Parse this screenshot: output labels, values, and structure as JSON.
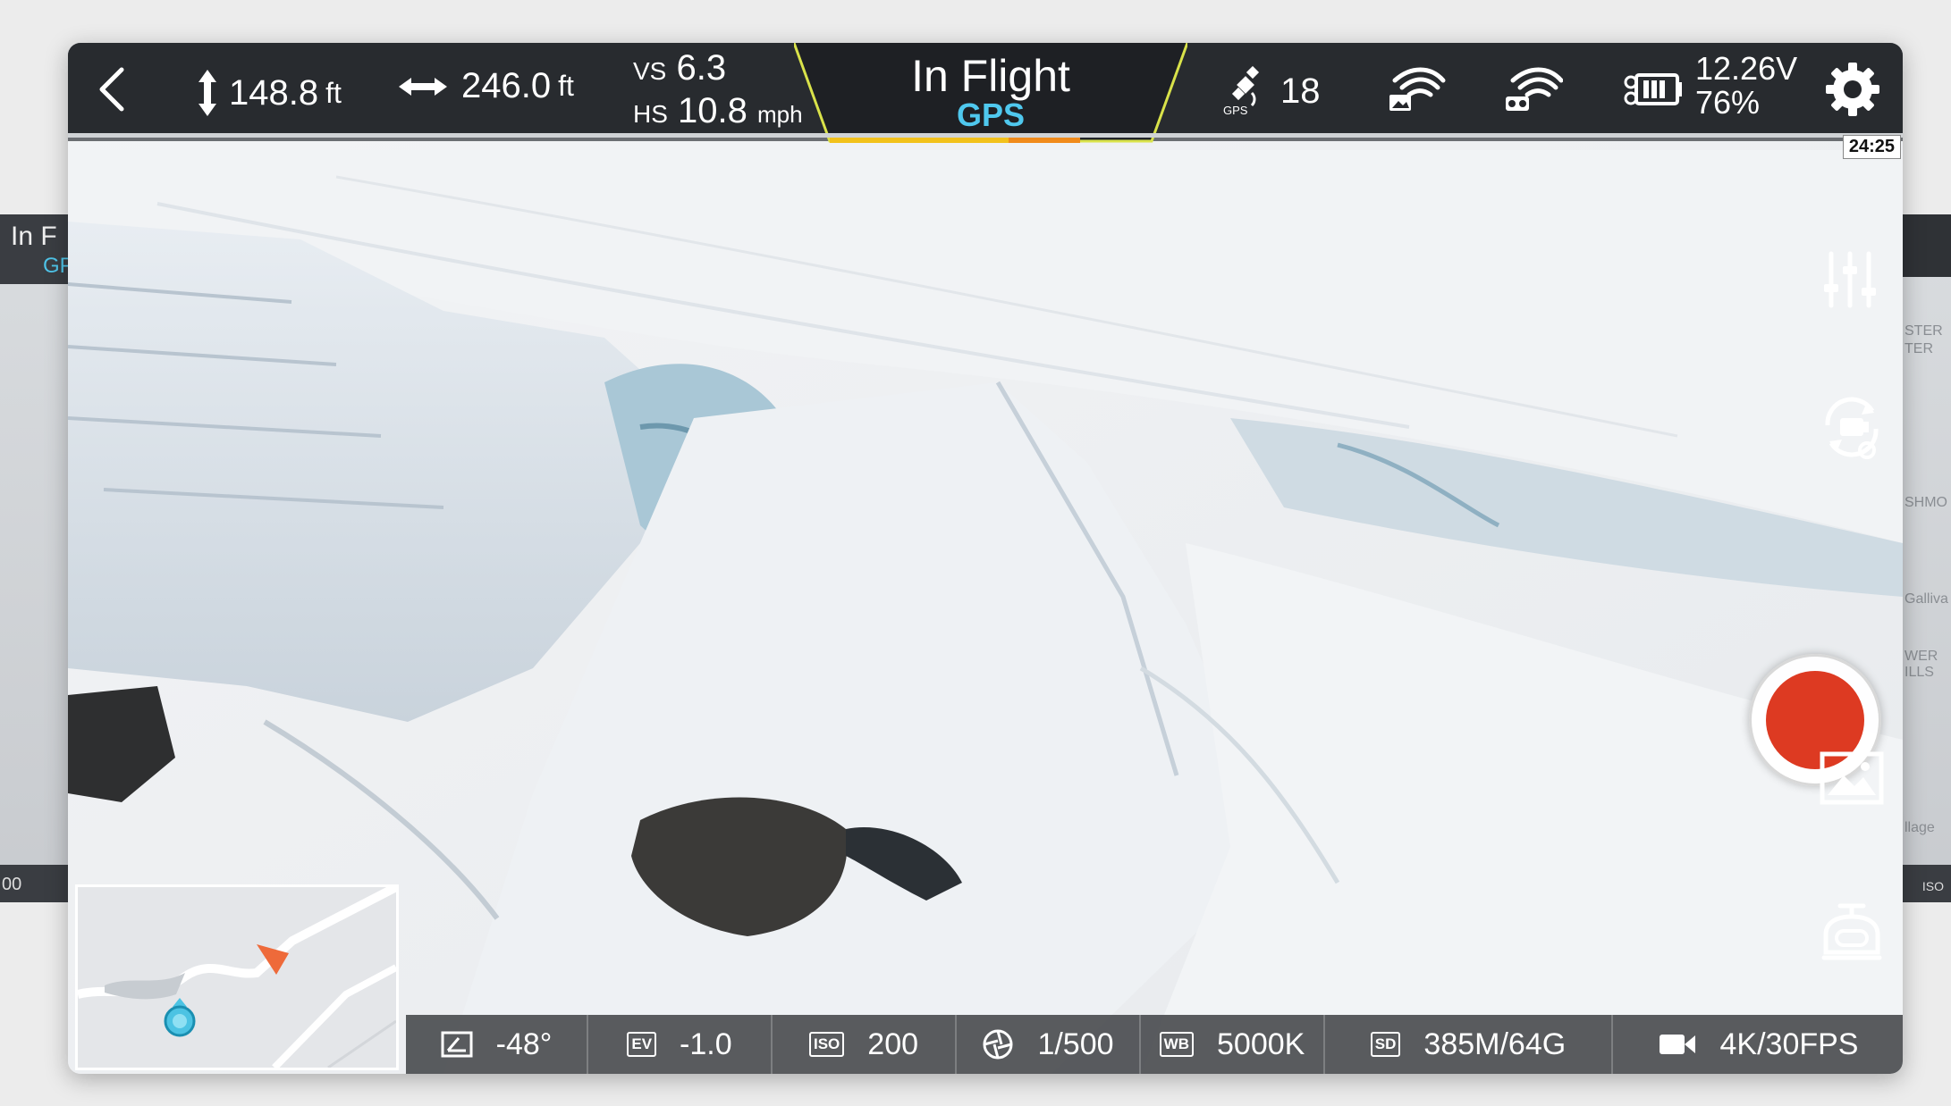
{
  "peek_left": {
    "title": "In F",
    "sub": "GP",
    "bottom": "00"
  },
  "peek_right": {
    "map_labels": [
      "STER",
      "TER",
      "SHMO",
      "Galliva",
      "WER",
      "ILLS",
      "llage"
    ],
    "bottom": "ISO"
  },
  "topbar": {
    "altitude": {
      "value": "148.8",
      "unit": "ft"
    },
    "distance": {
      "value": "246.0",
      "unit": "ft"
    },
    "vs_label": "VS",
    "vs_value": "6.3",
    "hs_label": "HS",
    "hs_value": "10.8",
    "hs_unit": "mph",
    "mode_title": "In Flight",
    "mode_sub": "GPS",
    "gps_label": "GPS",
    "satellites": "18",
    "voltage": "12.26V",
    "battery_percent": "76%"
  },
  "timer": "24:25",
  "bottombar": {
    "gimbal_pitch": "-48°",
    "ev_label": "EV",
    "ev_value": "-1.0",
    "iso_label": "ISO",
    "iso_value": "200",
    "shutter": "1/500",
    "white_balance_label": "WB",
    "white_balance": "5000K",
    "sd_label": "SD",
    "storage": "385M/64G",
    "video_format": "4K/30FPS"
  },
  "colors": {
    "record": "#dd3a22",
    "gps_accent": "#4fc8ee",
    "bar": "#24262a"
  }
}
